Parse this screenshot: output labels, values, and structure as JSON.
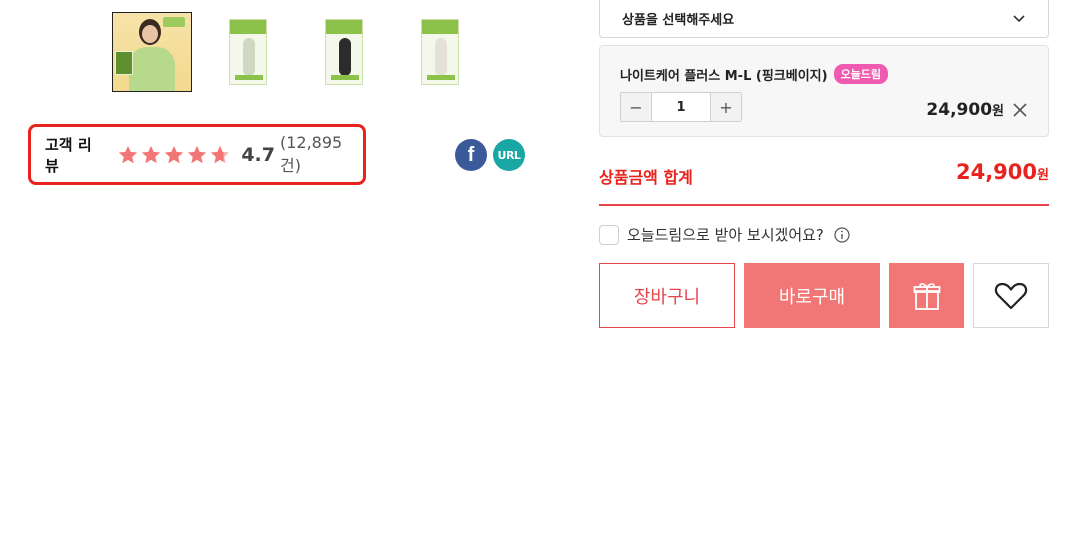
{
  "gallery": {
    "thumbnails": [
      {
        "kind": "model",
        "selected": true
      },
      {
        "kind": "package",
        "selected": false
      },
      {
        "kind": "package",
        "selected": false
      },
      {
        "kind": "package",
        "selected": false
      }
    ]
  },
  "review": {
    "label": "고객 리뷰",
    "rating": 4.7,
    "rating_text": "4.7",
    "count_text": "(12,895건)",
    "star_color": "#f27675",
    "highlight_color": "#e8231f"
  },
  "share": {
    "facebook_glyph": "f",
    "url_label": "URL"
  },
  "product_select": {
    "placeholder": "상품을 선택해주세요",
    "icon": "chevron-down-icon"
  },
  "selected_option": {
    "name": "나이트케어 플러스 M-L (핑크베이지)",
    "badge": "오늘드림",
    "quantity": "1",
    "minus": "−",
    "plus": "+",
    "price": "24,900",
    "currency": "원"
  },
  "total": {
    "label": "상품금액 합계",
    "price": "24,900",
    "currency": "원"
  },
  "delivery_option": {
    "label": "오늘드림으로 받아 보시겠어요?",
    "checked": false
  },
  "actions": {
    "cart_label": "장바구니",
    "buy_label": "바로구매",
    "gift_icon": "gift-icon",
    "wish_icon": "heart-icon"
  },
  "colors": {
    "accent_red": "#e8231f",
    "button_coral": "#f27675",
    "badge_pink": "#f05ab0"
  }
}
